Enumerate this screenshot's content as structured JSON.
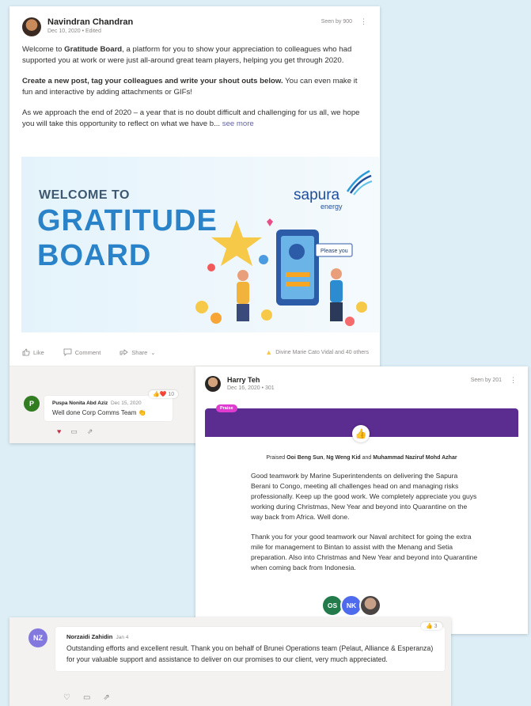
{
  "post1": {
    "author": "Navindran Chandran",
    "date": "Dec 10, 2020",
    "edited": "Edited",
    "seen": "Seen by 900",
    "more": "⋮",
    "intro_before": "Welcome to ",
    "intro_bold": "Gratitude Board",
    "intro_after": ", a platform for you to show your appreciation to  colleagues who had supported you at work or were just all-around great team players, helping you get through 2020.",
    "cta_bold": "Create a new post, tag your colleagues and write your shout outs below.",
    "cta_after": " You can even make it fun and interactive by adding attachments or GIFs!",
    "closing": "As we approach the end of 2020 – a year that is no doubt difficult and challenging for us all, we hope you will take this opportunity to reflect on what we have b...",
    "see_more": "see more",
    "banner": {
      "welcome": "WELCOME TO",
      "line1": "GRATITUDE",
      "line2": "BOARD",
      "brand": "sapura",
      "brand_sub": "energy",
      "sign": "Please you"
    },
    "actions": {
      "like": "Like",
      "comment": "Comment",
      "share": "Share"
    },
    "reactions_summary": "Divine Marie Cato Vidal and 40 others",
    "comment": {
      "initial": "P",
      "author": "Puspa Nonita Abd Aziz",
      "date": "Dec 15, 2020",
      "text": "Well done Corp Comms Team 👏",
      "reactions": "👍❤️ 10"
    }
  },
  "post2": {
    "author": "Harry Teh",
    "date": "Dec 16, 2020",
    "edited": "301",
    "seen": "Seen by 201",
    "more": "⋮",
    "tag": "Praise",
    "praised_prefix": "Praised ",
    "praised_1": "Ooi Beng Sun",
    "praised_2": "Ng Weng Kid",
    "praised_and": " and ",
    "praised_3": "Muhammad Naziruf Mohd Azhar",
    "para1": "Good teamwork by Marine Superintendents on delivering the Sapura Berani to Congo, meeting all challenges head on and managing risks professionally. Keep up the good work. We completely appreciate you guys working during Christmas, New Year and beyond into Quarantine on the way back from Africa. Well done.",
    "para2": "Thank you for your good teamwork our Naval architect for going the extra mile for management to Bintan to assist with the Menang and Setia preparation. Also into Christmas and New Year and beyond into Quarantine when coming back from Indonesia.",
    "people": [
      "OS",
      "NK"
    ]
  },
  "post3": {
    "initials": "NZ",
    "author": "Norzaidi Zahidin",
    "date": "Jan 4",
    "text": "Outstanding efforts and excellent result. Thank you on behalf of Brunei Operations team (Pelaut, Alliance & Esperanza) for your valuable support and assistance to deliver on our promises to our client, very much appreciated.",
    "reactions": "👍 3"
  },
  "colors": {
    "praise_bar": "#5b2d91",
    "praise_tag": "#e03bd0",
    "banner_text": "#2a83c8",
    "accent": "#6264a7"
  }
}
